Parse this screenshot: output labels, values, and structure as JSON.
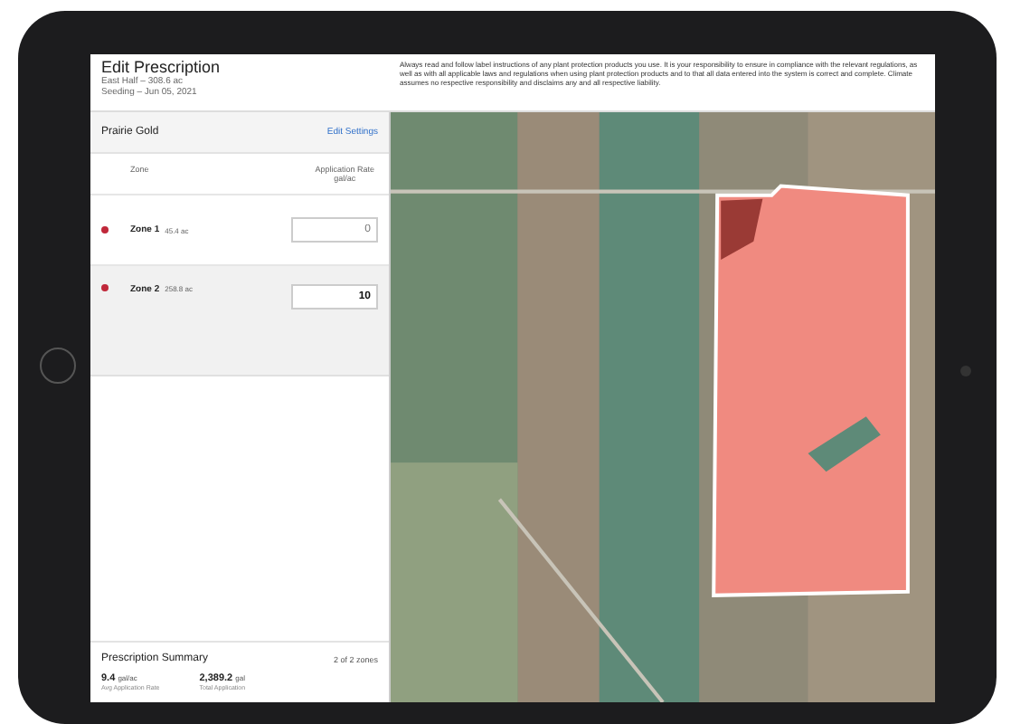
{
  "header": {
    "title": "Edit Prescription",
    "field": "East Half – 308.6 ac",
    "season": "Seeding – Jun 05, 2021",
    "disclaimer": "Always read and follow label instructions of any plant protection products you use. It is your responsibility to ensure in compliance with the relevant regulations, as well as with all applicable laws and regulations when using plant protection products and to that all data entered into the system is correct and complete. Climate assumes no respective responsibility and disclaims any and all respective liability."
  },
  "product": {
    "name": "Prairie Gold",
    "action": "Edit Settings"
  },
  "columns": {
    "zone": "Zone",
    "rate": "Application Rate",
    "unit": "gal/ac"
  },
  "zones": [
    {
      "name": "Zone 1",
      "area": "45.4 ac",
      "color": "#c0283a",
      "placeholder": "0",
      "selected": false
    },
    {
      "name": "Zone 2",
      "area": "258.8 ac",
      "color": "#c0283a",
      "value": "10",
      "selected": true
    }
  ],
  "summary": {
    "title": "Prescription Summary",
    "count": "2 of 2 zones",
    "stats": [
      {
        "value": "9.4",
        "unit": "gal/ac",
        "label": "Avg Application Rate"
      },
      {
        "value": "2,389.2",
        "unit": "gal",
        "label": "Total Application"
      }
    ]
  }
}
